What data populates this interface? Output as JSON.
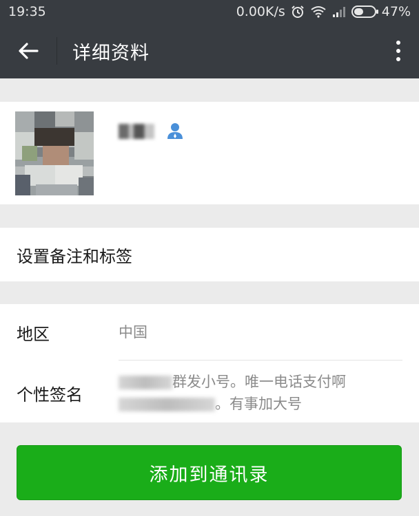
{
  "status_bar": {
    "time": "19:35",
    "network_speed": "0.00K/s",
    "battery_percent": "47%",
    "battery_level": 0.47,
    "icons": [
      "alarm-icon",
      "wifi-icon",
      "signal-icon",
      "battery-icon"
    ]
  },
  "app_bar": {
    "title": "详细资料",
    "back_icon": "arrow-left-icon",
    "more_icon": "more-vertical-icon"
  },
  "profile": {
    "avatar_icon": "avatar",
    "contact_icon": "person-icon",
    "accent_color": "#4a90d9"
  },
  "remark_row": {
    "label": "设置备注和标签"
  },
  "info": {
    "region_label": "地区",
    "region_value": "中国",
    "signature_label": "个性签名",
    "signature_line1": "群发小号。唯一电话支付啊",
    "signature_line2": "。有事加大号"
  },
  "actions": {
    "add_contact_label": "添加到通讯录",
    "button_color": "#1aad19"
  }
}
